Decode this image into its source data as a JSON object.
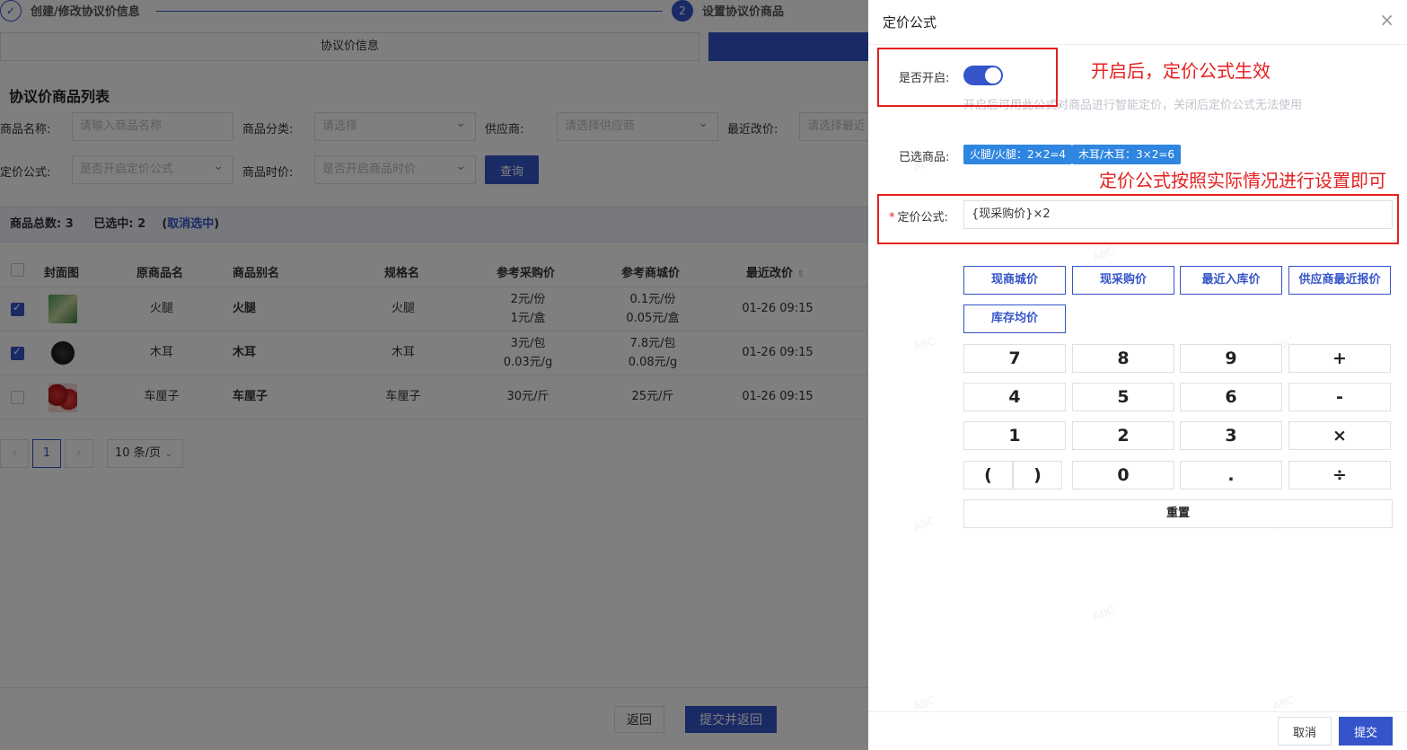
{
  "steps": {
    "step1_label": "创建/修改协议价信息",
    "step1_icon": "check-icon",
    "step2_number": "2",
    "step2_label": "设置协议价商品"
  },
  "tabs": {
    "info": "协议价信息"
  },
  "section_title": "协议价商品列表",
  "filters": {
    "name_label": "商品名称:",
    "name_placeholder": "请输入商品名称",
    "category_label": "商品分类:",
    "category_placeholder": "请选择",
    "supplier_label": "供应商:",
    "supplier_placeholder": "请选择供应商",
    "recent_label": "最近改价:",
    "recent_placeholder": "请选择最近",
    "formula_label": "定价公式:",
    "formula_placeholder": "是否开启定价公式",
    "timeprice_label": "商品时价:",
    "timeprice_placeholder": "是否开启商品时价",
    "query_button": "查询"
  },
  "summary": {
    "total_label": "商品总数:",
    "total_value": "3",
    "selected_label": "已选中:",
    "selected_value": "2",
    "open_paren": "(",
    "cancel_link": "取消选中",
    "close_paren": ")"
  },
  "table": {
    "headers": [
      "封面图",
      "原商品名",
      "商品别名",
      "规格名",
      "参考采购价",
      "参考商城价",
      "最近改价"
    ],
    "rows": [
      {
        "checked": true,
        "name": "火腿",
        "alias": "火腿",
        "spec": "火腿",
        "purchase_1": "2元/份",
        "purchase_2": "1元/盒",
        "mall_1": "0.1元/份",
        "mall_2": "0.05元/盒",
        "updated": "01-26 09:15"
      },
      {
        "checked": true,
        "name": "木耳",
        "alias": "木耳",
        "spec": "木耳",
        "purchase_1": "3元/包",
        "purchase_2": "0.03元/g",
        "mall_1": "7.8元/包",
        "mall_2": "0.08元/g",
        "updated": "01-26 09:15"
      },
      {
        "checked": false,
        "name": "车厘子",
        "alias": "车厘子",
        "spec": "车厘子",
        "purchase_1": "30元/斤",
        "purchase_2": "",
        "mall_1": "25元/斤",
        "mall_2": "",
        "updated": "01-26 09:15"
      }
    ]
  },
  "pager": {
    "prev": "‹",
    "current": "1",
    "next": "›",
    "size": "10 条/页"
  },
  "bottom": {
    "back": "返回",
    "submit_back": "提交并返回"
  },
  "drawer": {
    "title": "定价公式",
    "close": "×",
    "enable_label": "是否开启:",
    "enabled": true,
    "hint": "开启后可用此公式对商品进行智能定价，关闭后定价公式无法使用",
    "selected_label": "已选商品:",
    "tags": [
      "火腿/火腿：2×2=4",
      "木耳/木耳：3×2=6"
    ],
    "formula_required": "*",
    "formula_label": "定价公式:",
    "formula_value": "{现采购价}×2",
    "price_buttons": [
      "现商城价",
      "现采购价",
      "最近入库价",
      "供应商最近报价",
      "库存均价"
    ],
    "keys": [
      "7",
      "8",
      "9",
      "+",
      "4",
      "5",
      "6",
      "-",
      "1",
      "2",
      "3",
      "×",
      "(",
      ")",
      "0",
      ".",
      "÷"
    ],
    "reset": "重置",
    "cancel": "取消",
    "submit": "提交"
  },
  "annotations": {
    "note1": "开启后，定价公式生效",
    "note2": "定价公式按照实际情况进行设置即可"
  },
  "watermark": "ABC",
  "colors": {
    "primary": "#3554c9",
    "tag": "#2f86e0",
    "annotation": "#e52020"
  }
}
